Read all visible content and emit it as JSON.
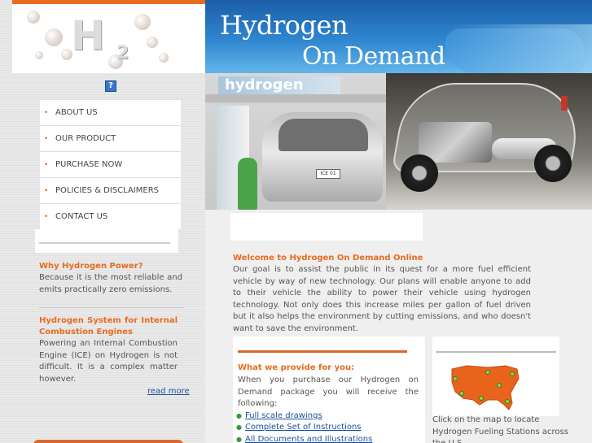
{
  "banner": {
    "title_line1": "Hydrogen",
    "title_line2": "On Demand"
  },
  "logo": {
    "mark": "H",
    "subscript": "2"
  },
  "help_icon": "?",
  "photo": {
    "station_sign": "hydrogen",
    "plate": "ICE 01"
  },
  "nav": {
    "items": [
      {
        "label": "ABOUT US"
      },
      {
        "label": "OUR PRODUCT"
      },
      {
        "label": "PURCHASE NOW"
      },
      {
        "label": "POLICIES & DISCLAIMERS"
      },
      {
        "label": "CONTACT US"
      }
    ]
  },
  "sidebar": {
    "why": {
      "heading": "Why Hydrogen Power?",
      "text": "Because it is the most reliable and emits practically zero emissions."
    },
    "system": {
      "heading": "Hydrogen System for Internal Combustion Engines",
      "text": "Powering an Internal Combustion Engine (ICE) on Hydrogen is not difficult. It is a complex matter however.",
      "read_more": "read more"
    }
  },
  "main": {
    "welcome": {
      "heading": "Welcome to Hydrogen On Demand Online",
      "text": "Our goal is to assist the public in its quest for a more fuel efficient vehicle by way of new technology. Our plans will enable anyone to add to their vehicle the ability to power their vehicle using hydrogen technology. Not only does this increase miles per gallon of fuel driven but it also helps the environment by cutting emissions, and who doesn't want to save the environment."
    },
    "provide": {
      "heading": "What we provide for you:",
      "text": "When you purchase our Hydrogen on Demand package you will receive the following:",
      "items": [
        {
          "label": "Full scale drawings"
        },
        {
          "label": "Complete Set of Instructions"
        },
        {
          "label": "All Documents and Illustrations"
        }
      ]
    },
    "map": {
      "caption": "Click on the map to locate Hydrogen Fueling Stations across the U.S."
    }
  },
  "colors": {
    "accent": "#e86b1f",
    "link": "#1a4f9c",
    "banner": "#2f86cf"
  },
  "icons": [
    "help-icon",
    "nav-bullet-icon",
    "list-bullet-icon",
    "us-map-icon"
  ]
}
